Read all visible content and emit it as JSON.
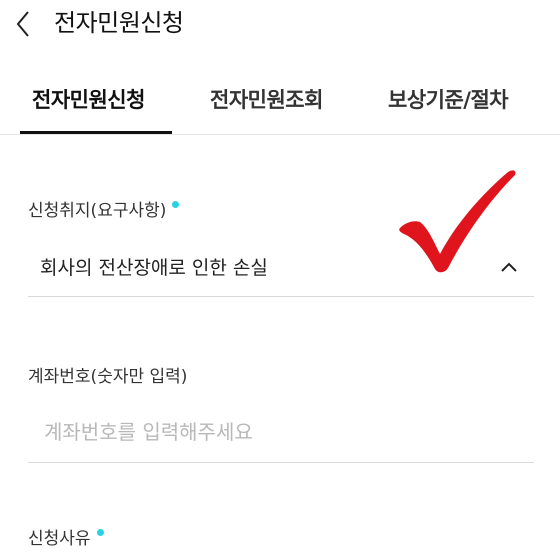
{
  "header": {
    "title": "전자민원신청"
  },
  "tabs": [
    {
      "label": "전자민원신청",
      "active": true
    },
    {
      "label": "전자민원조회",
      "active": false
    },
    {
      "label": "보상기준/절차",
      "active": false
    }
  ],
  "form": {
    "purpose": {
      "label": "신청취지(요구사항)",
      "required": true,
      "value": "회사의 전산장애로 인한 손실"
    },
    "account": {
      "label": "계좌번호(숫자만 입력)",
      "value": "",
      "placeholder": "계좌번호를 입력해주세요"
    },
    "reason": {
      "label": "신청사유",
      "required": true
    }
  },
  "colors": {
    "required_dot": "#27d3e3",
    "check_mark": "#e0141c"
  },
  "icons": {
    "back": "chevron-left-icon",
    "select": "chevron-up-icon",
    "overlay": "check-mark-icon"
  }
}
